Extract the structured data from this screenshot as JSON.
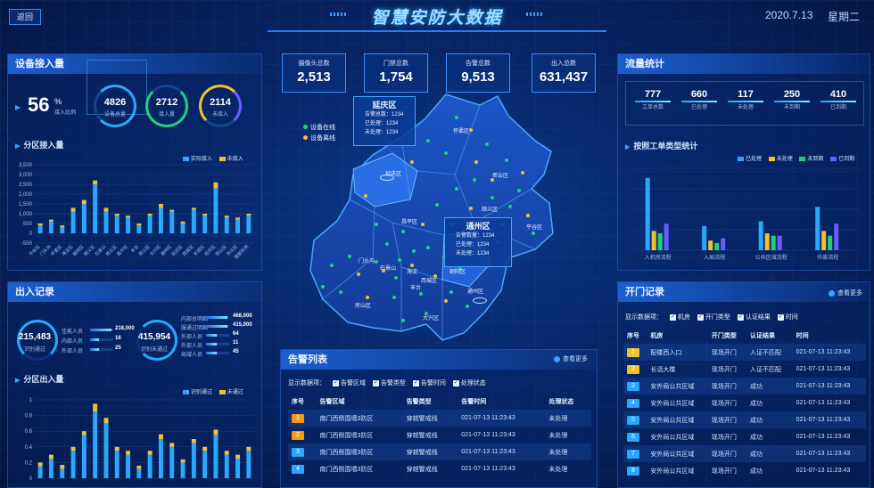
{
  "header": {
    "back": "返回",
    "title": "智慧安防大数据",
    "date": "2020.7.13",
    "weekday": "星期二"
  },
  "device": {
    "title": "设备接入量",
    "rate_value": "56",
    "rate_unit": "%",
    "rate_label": "接入比例",
    "rings": [
      {
        "value": "4826",
        "label": "设备总量"
      },
      {
        "value": "2712",
        "label": "接入量"
      },
      {
        "value": "2114",
        "label": "未接入"
      }
    ],
    "sub_title": "分区接入量",
    "legend": [
      "实际接入",
      "未接入"
    ]
  },
  "access": {
    "title": "出入记录",
    "total1_value": "215,483",
    "total1_label": "识别通过",
    "rows1": [
      {
        "label": "佳能人员",
        "value": "218,000"
      },
      {
        "label": "内部人员",
        "value": "16"
      },
      {
        "label": "外部人员",
        "value": "25"
      }
    ],
    "total2_value": "415,954",
    "total2_label": "识别未通过",
    "rows2": [
      {
        "label": "内部总明细",
        "value": "468,000"
      },
      {
        "label": "服通过明细",
        "value": "415,000"
      },
      {
        "label": "外部人员",
        "value": "64"
      },
      {
        "label": "外部人员",
        "value": "11"
      },
      {
        "label": "局域人员",
        "value": "45"
      }
    ],
    "sub_title": "分区出入量",
    "legend": [
      "识别通过",
      "未通过"
    ]
  },
  "stats": [
    {
      "label": "摄像头总数",
      "value": "2,513"
    },
    {
      "label": "门禁总数",
      "value": "1,754"
    },
    {
      "label": "告警总数",
      "value": "9,513"
    },
    {
      "label": "出入总数",
      "value": "631,437"
    }
  ],
  "map": {
    "legend_online": "设备在线",
    "legend_offline": "设备离线",
    "popup1": {
      "title": "延庆区",
      "l1": "告警总数：",
      "v1": "1234",
      "l2": "已处理：",
      "v2": "1234",
      "l3": "未处理：",
      "v3": "1234"
    },
    "popup2": {
      "title": "通州区",
      "l1": "告警数量：",
      "v1": "1234",
      "l2": "已处理：",
      "v2": "1234",
      "l3": "未处理：",
      "v3": "1234"
    },
    "districts": [
      "延庆区",
      "怀柔区",
      "密云区",
      "昌平区",
      "平谷区",
      "顺义区",
      "门头沟",
      "石景山",
      "海淀",
      "朝阳区",
      "西城区",
      "丰台",
      "房山区",
      "大兴区",
      "通州区"
    ]
  },
  "flow": {
    "title": "流量统计",
    "items": [
      {
        "value": "777",
        "label": "工单总数"
      },
      {
        "value": "660",
        "label": "已处理"
      },
      {
        "value": "117",
        "label": "未处理"
      },
      {
        "value": "250",
        "label": "未到期"
      },
      {
        "value": "410",
        "label": "已到期"
      }
    ],
    "sub_title": "按照工单类型统计",
    "legend": [
      "已处理",
      "未处理",
      "未到期",
      "已到期"
    ]
  },
  "door": {
    "title": "开门记录",
    "more": "查看更多",
    "filter_label": "显示数据项：",
    "filters": [
      "机房",
      "开门类型",
      "认证结果",
      "时间"
    ],
    "headers": [
      "序号",
      "机房",
      "开门类型",
      "认证结果",
      "时间"
    ],
    "rows": [
      {
        "no": "1",
        "room": "配楼西入口",
        "type": "现场开门",
        "result": "入证不匹配",
        "time": "021-07-13 11:23:43"
      },
      {
        "no": "2",
        "room": "长话大楼",
        "type": "现场开门",
        "result": "入证不匹配",
        "time": "021-07-13 11:23:43"
      },
      {
        "no": "3",
        "room": "安外局公共区域",
        "type": "现场开门",
        "result": "成功",
        "time": "021-07-13 11:23:43"
      },
      {
        "no": "4",
        "room": "安外局公共区域",
        "type": "现场开门",
        "result": "成功",
        "time": "021-07-13 11:23:43"
      },
      {
        "no": "5",
        "room": "安外局公共区域",
        "type": "现场开门",
        "result": "成功",
        "time": "021-07-13 11:23:43"
      },
      {
        "no": "6",
        "room": "安外局公共区域",
        "type": "现场开门",
        "result": "成功",
        "time": "021-07-13 11:23:43"
      },
      {
        "no": "7",
        "room": "安外局公共区域",
        "type": "现场开门",
        "result": "成功",
        "time": "021-07-13 11:23:43"
      },
      {
        "no": "8",
        "room": "安外局公共区域",
        "type": "现场开门",
        "result": "成功",
        "time": "021-07-13 11:23:43"
      }
    ]
  },
  "alarm": {
    "title": "告警列表",
    "more": "查看更多",
    "filter_label": "显示数据项：",
    "filters": [
      "告警区域",
      "告警类型",
      "告警时间",
      "处理状态"
    ],
    "headers": [
      "序号",
      "告警区域",
      "告警类型",
      "告警时间",
      "处理状态"
    ],
    "rows": [
      {
        "no": "1",
        "area": "南门西侧围墙3防区",
        "type": "穿越警戒线",
        "time": "021-07-13 11:23:43",
        "status": "未处理"
      },
      {
        "no": "2",
        "area": "南门西侧围墙3防区",
        "type": "穿越警戒线",
        "time": "021-07-13 11:23:43",
        "status": "未处理"
      },
      {
        "no": "3",
        "area": "南门西侧围墙3防区",
        "type": "穿越警戒线",
        "time": "021-07-13 11:23:43",
        "status": "未处理"
      },
      {
        "no": "4",
        "area": "南门西侧围墙3防区",
        "type": "穿越警戒线",
        "time": "021-07-13 11:23:43",
        "status": "未处理"
      }
    ]
  },
  "colors": {
    "accent": "#3fa0ff",
    "bar_primary": "#2aa8ff",
    "bar_secondary": "#f2c12e",
    "green": "#22d07a",
    "purple": "#6a5cff",
    "orange": "#f39c12"
  },
  "chart_data": [
    {
      "type": "bar",
      "title": "分区接入量",
      "ylim": [
        -500,
        3500
      ],
      "yticks": [
        "3,500",
        "3,000",
        "2,500",
        "2,000",
        "1,500",
        "1,000",
        "500",
        "0",
        "-500"
      ],
      "categories": [
        "平谷区",
        "门头沟",
        "怀柔区",
        "海淀区",
        "朝阳区",
        "顺义区",
        "石景山",
        "密云区",
        "昌平区",
        "丰台",
        "房山区",
        "大兴区",
        "通州区",
        "延庆区",
        "西城区",
        "东城区",
        "经开区",
        "燕山区",
        "亦庄区",
        "首都机场"
      ],
      "series": [
        {
          "name": "实际接入",
          "values": [
            400,
            600,
            300,
            1100,
            1500,
            2500,
            1100,
            900,
            800,
            400,
            900,
            1300,
            1100,
            500,
            1200,
            900,
            2300,
            800,
            700,
            900
          ]
        },
        {
          "name": "未接入",
          "values": [
            100,
            100,
            100,
            200,
            200,
            200,
            200,
            100,
            100,
            100,
            100,
            200,
            100,
            100,
            100,
            100,
            300,
            100,
            100,
            100
          ]
        }
      ]
    },
    {
      "type": "bar",
      "title": "分区出入量",
      "ylim": [
        0,
        1
      ],
      "yticks": [
        "1",
        "0.8",
        "0.6",
        "0.4",
        "0.2",
        "0"
      ],
      "series": [
        {
          "name": "识别通过",
          "values": [
            0.15,
            0.25,
            0.12,
            0.35,
            0.55,
            0.85,
            0.7,
            0.35,
            0.3,
            0.12,
            0.3,
            0.5,
            0.4,
            0.2,
            0.45,
            0.35,
            0.55,
            0.3,
            0.25,
            0.35
          ]
        },
        {
          "name": "未通过",
          "values": [
            0.05,
            0.05,
            0.05,
            0.05,
            0.05,
            0.1,
            0.07,
            0.05,
            0.05,
            0.04,
            0.05,
            0.06,
            0.05,
            0.04,
            0.05,
            0.05,
            0.07,
            0.05,
            0.05,
            0.05
          ]
        }
      ]
    },
    {
      "type": "bar",
      "title": "按照工单类型统计",
      "categories": [
        "入机房流程",
        "入局流程",
        "公共区域流程",
        "作废流程"
      ],
      "series": [
        {
          "name": "已处理",
          "values": [
            150,
            50,
            60,
            90
          ]
        },
        {
          "name": "未处理",
          "values": [
            40,
            20,
            35,
            40
          ]
        },
        {
          "name": "未到期",
          "values": [
            35,
            15,
            30,
            30
          ]
        },
        {
          "name": "已到期",
          "values": [
            55,
            25,
            30,
            55
          ]
        }
      ]
    }
  ]
}
